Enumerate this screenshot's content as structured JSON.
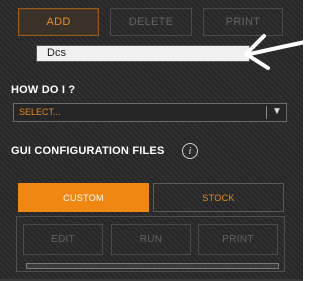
{
  "toolbar": {
    "add_label": "ADD",
    "delete_label": "DELETE",
    "print_label": "PRINT"
  },
  "text_field": {
    "value": "Dcs"
  },
  "how_do_i": {
    "label": "HOW DO I ?",
    "select_value": "SELECT..."
  },
  "gui_config": {
    "label": "GUI CONFIGURATION FILES",
    "info_icon": "info-icon",
    "tabs": [
      {
        "label": "CUSTOM",
        "active": true
      },
      {
        "label": "STOCK",
        "active": false
      }
    ],
    "actions": {
      "edit_label": "EDIT",
      "run_label": "RUN",
      "print_label": "PRINT"
    }
  },
  "colors": {
    "accent": "#ef8712",
    "panel_bg": "#2b2b2b",
    "annotation": "#ffffff"
  }
}
